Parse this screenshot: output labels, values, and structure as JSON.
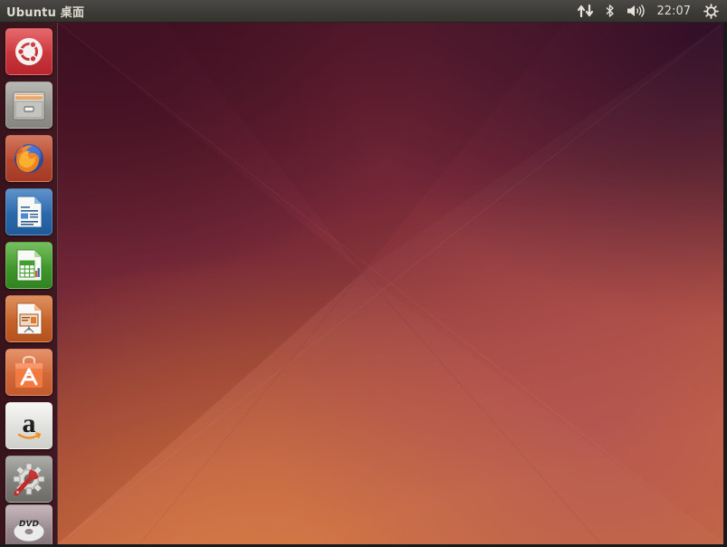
{
  "panel": {
    "title": "Ubuntu 桌面",
    "clock": "22:07",
    "indicators": [
      "network-updown-icon",
      "bluetooth-icon",
      "volume-icon",
      "session-gear-icon"
    ]
  },
  "launcher": {
    "items": [
      {
        "name": "dash-home",
        "icon": "ubuntu-logo-icon",
        "tile_color": "#c8343a"
      },
      {
        "name": "files",
        "icon": "file-cabinet-icon",
        "tile_color": "#b8b8b2"
      },
      {
        "name": "firefox",
        "icon": "firefox-icon",
        "tile_color": "#c04a2a"
      },
      {
        "name": "libreoffice-writer",
        "icon": "writer-document-icon",
        "tile_color": "#2a6aa8"
      },
      {
        "name": "libreoffice-calc",
        "icon": "calc-spreadsheet-icon",
        "tile_color": "#3f9a2c"
      },
      {
        "name": "libreoffice-impress",
        "icon": "impress-presentation-icon",
        "tile_color": "#c8642a"
      },
      {
        "name": "ubuntu-software-center",
        "icon": "software-center-bag-icon",
        "tile_color": "#e0663a"
      },
      {
        "name": "amazon",
        "icon": "amazon-logo-icon",
        "tile_color": "#e8e8e8"
      },
      {
        "name": "system-settings",
        "icon": "settings-gear-wrench-icon",
        "tile_color": "#8a8a8a"
      },
      {
        "name": "dvd-drive",
        "icon": "dvd-disc-icon",
        "tile_color": "#9a8a90"
      }
    ],
    "dvd_label": "DVD"
  },
  "colors": {
    "panel": "#3c3b37",
    "desktop_dark": "#3a0f24",
    "desktop_mid": "#7a2c3c",
    "desktop_warm": "#c8643c",
    "desktop_purple": "#5a2848"
  },
  "amazon_letter": "a"
}
